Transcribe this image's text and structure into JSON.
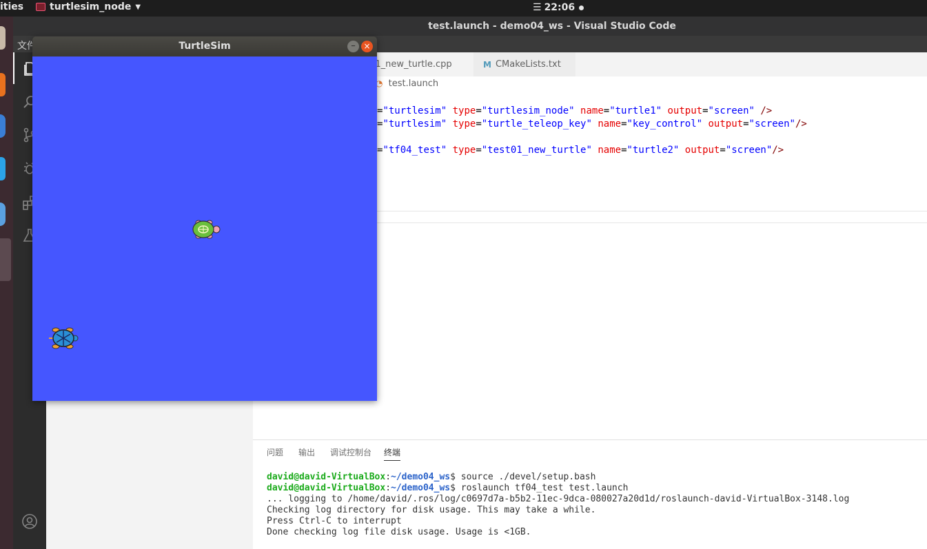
{
  "topbar": {
    "activities_label": "ities",
    "app_name": "turtlesim_node",
    "clock_icon": "☰",
    "clock_time": "22:06"
  },
  "vscode": {
    "window_title": "test.launch - demo04_ws - Visual Studio Code",
    "menu_first": "文件",
    "tabs": [
      {
        "label": "t01_new_turtle.cpp",
        "icon": "cpp-file-icon"
      },
      {
        "label": "CMakeLists.txt",
        "icon": "cmake-M-icon"
      }
    ],
    "breadcrumb": "test.launch",
    "code_lines": [
      {
        "p1": "=",
        "s1": "\"turtlesim\"",
        "a1": " type",
        "p2": "=",
        "s2": "\"turtlesim_node\"",
        "a2": " name",
        "p3": "=",
        "s3": "\"turtle1\"",
        "a3": " output",
        "p4": "=",
        "s4": "\"screen\"",
        "tail": " />"
      },
      {
        "p1": "=",
        "s1": "\"turtlesim\"",
        "a1": " type",
        "p2": "=",
        "s2": "\"turtle_teleop_key\"",
        "a2": " name",
        "p3": "=",
        "s3": "\"key_control\"",
        "a3": " output",
        "p4": "=",
        "s4": "\"screen\"",
        "tail": "/>"
      },
      {
        "p1": "=",
        "s1": "\"tf04_test\"",
        "a1": " type",
        "p2": "=",
        "s2": "\"test01_new_turtle\"",
        "a2": " name",
        "p3": "=",
        "s3": "\"turtle2\"",
        "a3": " output",
        "p4": "=",
        "s4": "\"screen\"",
        "tail": "/>"
      }
    ],
    "panel_tabs": [
      "问题",
      "输出",
      "调试控制台",
      "终端"
    ],
    "terminal": [
      {
        "user": "david@david-VirtualBox",
        "sep": ":",
        "path": "~/demo04_ws",
        "cmd": "$ source ./devel/setup.bash"
      },
      {
        "user": "david@david-VirtualBox",
        "sep": ":",
        "path": "~/demo04_ws",
        "cmd": "$ roslaunch tf04_test test.launch"
      }
    ],
    "terminal_output": [
      "... logging to /home/david/.ros/log/c0697d7a-b5b2-11ec-9dca-080027a20d1d/roslaunch-david-VirtualBox-3148.log",
      "Checking log directory for disk usage. This may take a while.",
      "Press Ctrl-C to interrupt",
      "Done checking log file disk usage. Usage is <1GB."
    ]
  },
  "turtlesim": {
    "title": "TurtleSim",
    "minimize_glyph": "–",
    "close_glyph": "×",
    "background_color": "#4556ff",
    "turtles": [
      {
        "name": "turtle1",
        "shell_color": "#6abf3c"
      },
      {
        "name": "turtle2",
        "shell_color": "#2a8fd6"
      }
    ]
  }
}
